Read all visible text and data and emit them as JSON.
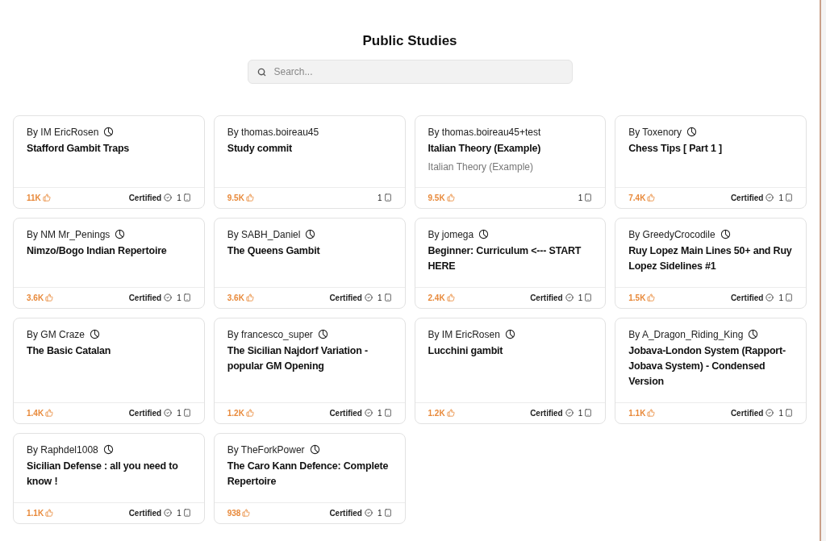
{
  "page_title": "Public Studies",
  "search": {
    "placeholder": "Search..."
  },
  "studies": [
    {
      "author": "By IM EricRosen",
      "author_icon": true,
      "title": "Stafford Gambit Traps",
      "likes": "11K",
      "certified": true,
      "certified_label": "Certified",
      "chapters": "1"
    },
    {
      "author": "By thomas.boireau45",
      "author_icon": false,
      "title": "Study commit",
      "likes": "9.5K",
      "certified": false,
      "chapters": "1"
    },
    {
      "author": "By thomas.boireau45+test",
      "author_icon": false,
      "title": "Italian Theory (Example)",
      "description": "Italian Theory (Example)",
      "likes": "9.5K",
      "certified": false,
      "chapters": "1"
    },
    {
      "author": "By Toxenory",
      "author_icon": true,
      "title": "Chess Tips [ Part 1 ]",
      "likes": "7.4K",
      "certified": true,
      "certified_label": "Certified",
      "chapters": "1"
    },
    {
      "author": "By NM Mr_Penings",
      "author_icon": true,
      "title": "Nimzo/Bogo Indian Repertoire",
      "likes": "3.6K",
      "certified": true,
      "certified_label": "Certified",
      "chapters": "1"
    },
    {
      "author": "By SABH_Daniel",
      "author_icon": true,
      "title": "The Queens Gambit",
      "likes": "3.6K",
      "certified": true,
      "certified_label": "Certified",
      "chapters": "1"
    },
    {
      "author": "By jomega",
      "author_icon": true,
      "title": "Beginner: Curriculum <--- START HERE",
      "likes": "2.4K",
      "certified": true,
      "certified_label": "Certified",
      "chapters": "1"
    },
    {
      "author": "By GreedyCrocodile",
      "author_icon": true,
      "title": "Ruy Lopez Main Lines 50+ and Ruy Lopez Sidelines #1",
      "likes": "1.5K",
      "certified": true,
      "certified_label": "Certified",
      "chapters": "1"
    },
    {
      "author": "By GM Craze",
      "author_icon": true,
      "title": "The Basic Catalan",
      "likes": "1.4K",
      "certified": true,
      "certified_label": "Certified",
      "chapters": "1"
    },
    {
      "author": "By francesco_super",
      "author_icon": true,
      "title": "The Sicilian Najdorf Variation - popular GM Opening",
      "likes": "1.2K",
      "certified": true,
      "certified_label": "Certified",
      "chapters": "1"
    },
    {
      "author": "By IM EricRosen",
      "author_icon": true,
      "title": "Lucchini gambit",
      "likes": "1.2K",
      "certified": true,
      "certified_label": "Certified",
      "chapters": "1"
    },
    {
      "author": "By A_Dragon_Riding_King",
      "author_icon": true,
      "title": "Jobava-London System (Rapport-Jobava System) - Condensed Version",
      "likes": "1.1K",
      "certified": true,
      "certified_label": "Certified",
      "chapters": "1"
    },
    {
      "author": "By Raphdel1008",
      "author_icon": true,
      "title": "Sicilian Defense : all you need to know !",
      "likes": "1.1K",
      "certified": true,
      "certified_label": "Certified",
      "chapters": "1"
    },
    {
      "author": "By TheForkPower",
      "author_icon": true,
      "title": "The Caro Kann Defence: Complete Repertoire",
      "likes": "938",
      "certified": true,
      "certified_label": "Certified",
      "chapters": "1"
    }
  ]
}
